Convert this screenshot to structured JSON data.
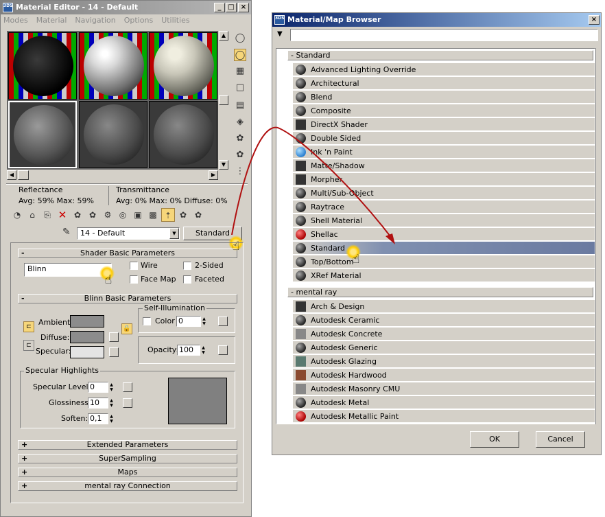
{
  "material_editor": {
    "title": "Material Editor - 14 - Default",
    "icon": "3DS",
    "title_buttons": {
      "minimize": "_",
      "maximize": "□",
      "close": "×"
    },
    "menu": [
      "Modes",
      "Material",
      "Navigation",
      "Options",
      "Utilities"
    ],
    "reflectance_label": "Reflectance",
    "reflectance_values": "Avg:  59% Max:  59%",
    "transmittance_label": "Transmittance",
    "transmittance_values": "Avg:   0% Max:   0% Diffuse:   0%",
    "material_name": "14 - Default",
    "type_button": "Standard",
    "rollouts": {
      "shader_basic": "Shader Basic Parameters",
      "blinn_basic": "Blinn Basic Parameters",
      "extended": "Extended Parameters",
      "supersampling": "SuperSampling",
      "maps": "Maps",
      "mental_ray": "mental ray Connection"
    },
    "shader": "Blinn",
    "checkboxes": {
      "wire": "Wire",
      "two_sided": "2-Sided",
      "face_map": "Face Map",
      "faceted": "Faceted"
    },
    "self_illum_title": "Self-Illumination",
    "color_label": "Color",
    "color_value": "0",
    "ambient_label": "Ambient:",
    "diffuse_label": "Diffuse:",
    "specular_label": "Specular:",
    "opacity_label": "Opacity:",
    "opacity_value": "100",
    "spec_highlights_title": "Specular Highlights",
    "spec_level_label": "Specular Level:",
    "spec_level_value": "0",
    "glossiness_label": "Glossiness:",
    "glossiness_value": "10",
    "soften_label": "Soften:",
    "soften_value": "0,1",
    "rollout_minus": "-",
    "rollout_plus": "+"
  },
  "browser": {
    "title": "Material/Map Browser",
    "icon": "3DS",
    "close": "×",
    "search_value": "",
    "group_standard": "- Standard",
    "standard_items": [
      {
        "label": "Advanced Lighting Override",
        "icon": "sphere"
      },
      {
        "label": "Architectural",
        "icon": "sphere"
      },
      {
        "label": "Blend",
        "icon": "sphere"
      },
      {
        "label": "Composite",
        "icon": "sphere"
      },
      {
        "label": "DirectX Shader",
        "icon": "square"
      },
      {
        "label": "Double Sided",
        "icon": "sphere"
      },
      {
        "label": "Ink 'n Paint",
        "icon": "blue"
      },
      {
        "label": "Matte/Shadow",
        "icon": "square"
      },
      {
        "label": "Morpher",
        "icon": "square"
      },
      {
        "label": "Multi/Sub-Object",
        "icon": "sphere"
      },
      {
        "label": "Raytrace",
        "icon": "sphere"
      },
      {
        "label": "Shell Material",
        "icon": "sphere"
      },
      {
        "label": "Shellac",
        "icon": "red"
      },
      {
        "label": "Standard",
        "icon": "sphere",
        "selected": true
      },
      {
        "label": "Top/Bottom",
        "icon": "sphere"
      },
      {
        "label": "XRef Material",
        "icon": "sphere"
      }
    ],
    "group_mental_ray": "- mental ray",
    "mental_ray_items": [
      {
        "label": "Arch & Design",
        "icon": "square"
      },
      {
        "label": "Autodesk Ceramic",
        "icon": "sphere"
      },
      {
        "label": "Autodesk Concrete",
        "icon": "brick"
      },
      {
        "label": "Autodesk Generic",
        "icon": "sphere"
      },
      {
        "label": "Autodesk Glazing",
        "icon": "teal"
      },
      {
        "label": "Autodesk Hardwood",
        "icon": "brown"
      },
      {
        "label": "Autodesk Masonry CMU",
        "icon": "brick"
      },
      {
        "label": "Autodesk Metal",
        "icon": "sphere"
      },
      {
        "label": "Autodesk Metallic Paint",
        "icon": "red"
      }
    ],
    "ok_label": "OK",
    "cancel_label": "Cancel"
  }
}
